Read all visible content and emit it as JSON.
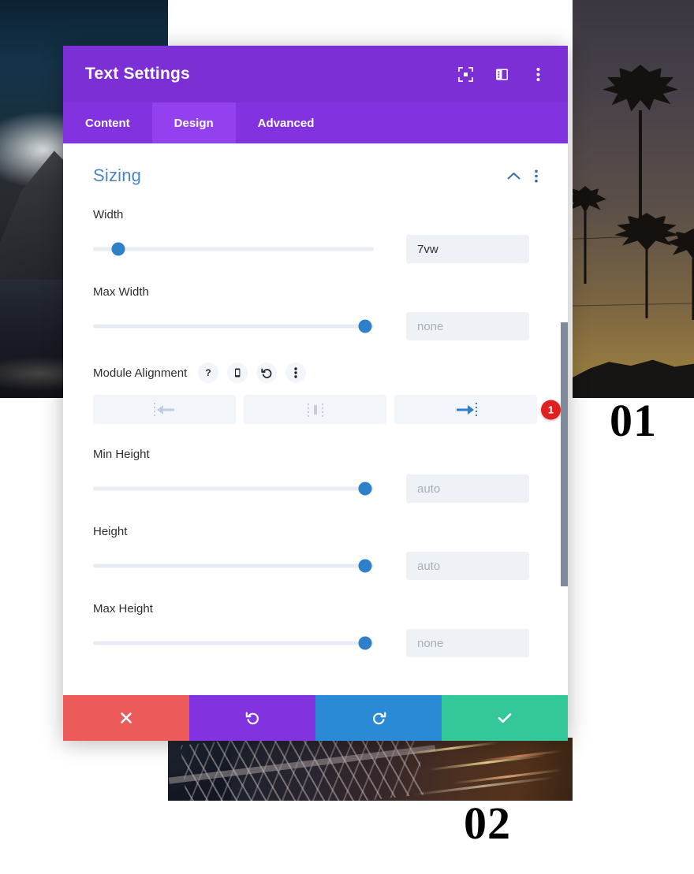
{
  "modal": {
    "title": "Text Settings",
    "header_icons": [
      {
        "name": "fullscreen-icon",
        "label": "expand"
      },
      {
        "name": "layout-panel-icon",
        "label": "layout"
      },
      {
        "name": "more-vertical-icon",
        "label": "more"
      }
    ],
    "tabs": [
      {
        "label": "Content",
        "active": false
      },
      {
        "label": "Design",
        "active": true
      },
      {
        "label": "Advanced",
        "active": false
      }
    ],
    "section": {
      "title": "Sizing",
      "collapse_icon": "chevron-up-icon",
      "menu_icon": "more-vertical-icon"
    },
    "fields": [
      {
        "label": "Width",
        "value": "7vw",
        "placeholder": "",
        "slider_percent": 9
      },
      {
        "label": "Max Width",
        "value": "",
        "placeholder": "none",
        "slider_percent": 97
      },
      {
        "label": "Min Height",
        "value": "",
        "placeholder": "auto",
        "slider_percent": 97
      },
      {
        "label": "Height",
        "value": "",
        "placeholder": "auto",
        "slider_percent": 97
      },
      {
        "label": "Max Height",
        "value": "",
        "placeholder": "none",
        "slider_percent": 97
      }
    ],
    "module_alignment": {
      "label": "Module Alignment",
      "icon_buttons": [
        {
          "name": "help-icon",
          "glyph": "?"
        },
        {
          "name": "responsive-mobile-icon",
          "glyph": "phone"
        },
        {
          "name": "reset-icon",
          "glyph": "undo"
        },
        {
          "name": "more-vertical-icon",
          "glyph": "dots"
        }
      ],
      "options": [
        {
          "name": "align-left",
          "active": false
        },
        {
          "name": "align-center",
          "active": false
        },
        {
          "name": "align-right",
          "active": true
        }
      ],
      "badge": "1"
    },
    "footer_buttons": [
      {
        "name": "cancel-button",
        "icon": "close-icon",
        "color": "#ec5a5a"
      },
      {
        "name": "undo-button",
        "icon": "undo-icon",
        "color": "#8233df"
      },
      {
        "name": "redo-button",
        "icon": "redo-icon",
        "color": "#2b8ad6"
      },
      {
        "name": "save-button",
        "icon": "check-icon",
        "color": "#34c79a"
      }
    ]
  },
  "background": {
    "number_01": "01",
    "number_02": "02"
  },
  "colors": {
    "header_purple": "#7b2fd4",
    "tabs_purple": "#8233df",
    "tab_active_purple": "#9341ee",
    "section_blue": "#4a86c5",
    "slider_blue": "#2e80c8",
    "badge_red": "#e02020",
    "input_bg": "#eef1f6"
  }
}
